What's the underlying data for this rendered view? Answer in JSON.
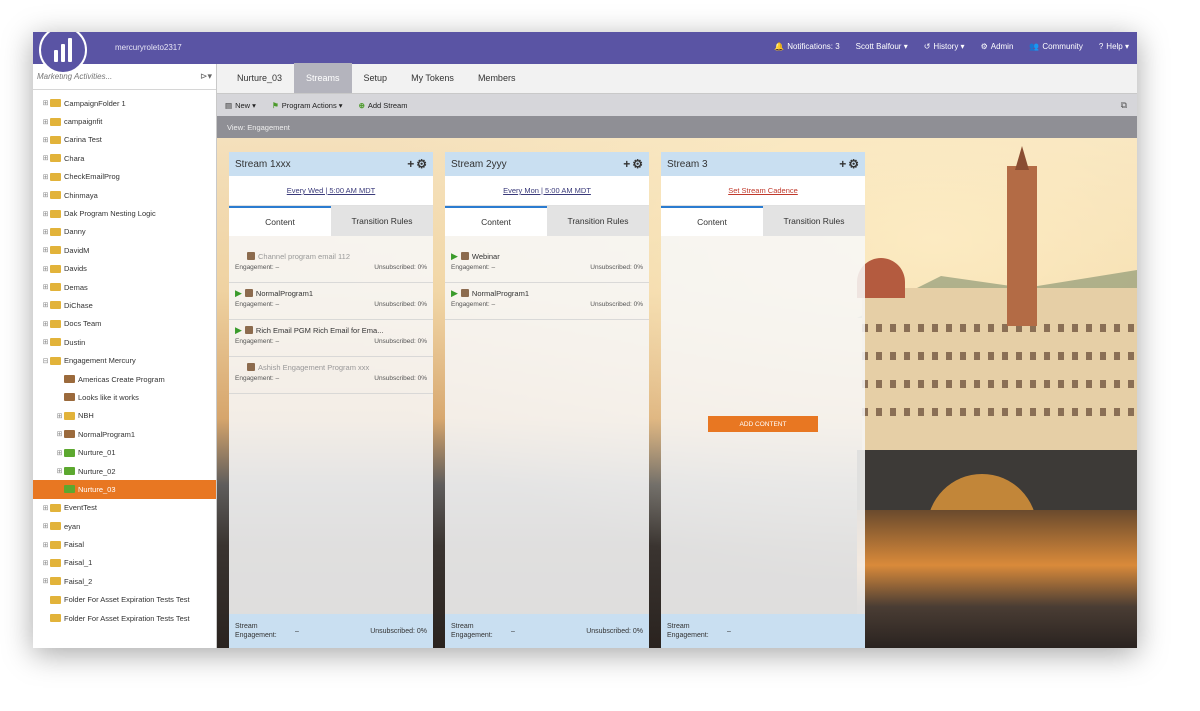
{
  "app": {
    "subscription": "mercuryroleto2317"
  },
  "topnav": [
    {
      "icon": "bell-icon",
      "glyph": "🔔",
      "label": "Notifications: 3"
    },
    {
      "icon": "user-icon",
      "glyph": "",
      "label": "Scott Balfour ▾"
    },
    {
      "icon": "history-icon",
      "glyph": "↺",
      "label": "History ▾"
    },
    {
      "icon": "admin-icon",
      "glyph": "⚙",
      "label": "Admin"
    },
    {
      "icon": "community-icon",
      "glyph": "👥",
      "label": "Community"
    },
    {
      "icon": "help-icon",
      "glyph": "?",
      "label": "Help ▾"
    }
  ],
  "sidebar": {
    "search_placeholder": "Marketing Activities...",
    "items": [
      {
        "label": "CampaignFolder 1",
        "type": "folder",
        "indent": 0,
        "exp": "⊞"
      },
      {
        "label": "campaignfit",
        "type": "folder",
        "indent": 0,
        "exp": "⊞"
      },
      {
        "label": "Carina Test",
        "type": "folder",
        "indent": 0,
        "exp": "⊞"
      },
      {
        "label": "Chara",
        "type": "folder",
        "indent": 0,
        "exp": "⊞"
      },
      {
        "label": "CheckEmailProg",
        "type": "folder",
        "indent": 0,
        "exp": "⊞"
      },
      {
        "label": "Chinmaya",
        "type": "folder",
        "indent": 0,
        "exp": "⊞"
      },
      {
        "label": "Dak Program Nesting Logic",
        "type": "folder",
        "indent": 0,
        "exp": "⊞"
      },
      {
        "label": "Danny",
        "type": "folder",
        "indent": 0,
        "exp": "⊞"
      },
      {
        "label": "DavidM",
        "type": "folder",
        "indent": 0,
        "exp": "⊞"
      },
      {
        "label": "Davids",
        "type": "folder",
        "indent": 0,
        "exp": "⊞"
      },
      {
        "label": "Demas",
        "type": "folder",
        "indent": 0,
        "exp": "⊞"
      },
      {
        "label": "DiChase",
        "type": "folder",
        "indent": 0,
        "exp": "⊞"
      },
      {
        "label": "Docs Team",
        "type": "folder",
        "indent": 0,
        "exp": "⊞"
      },
      {
        "label": "Dustin",
        "type": "folder",
        "indent": 0,
        "exp": "⊞"
      },
      {
        "label": "Engagement Mercury",
        "type": "folder",
        "indent": 0,
        "exp": "⊟"
      },
      {
        "label": "Americas Create Program",
        "type": "prog",
        "indent": 1,
        "exp": ""
      },
      {
        "label": "Looks like it works",
        "type": "prog",
        "indent": 1,
        "exp": ""
      },
      {
        "label": "NBH",
        "type": "folder",
        "indent": 1,
        "exp": "⊞"
      },
      {
        "label": "NormalProgram1",
        "type": "prog",
        "indent": 1,
        "exp": "⊞"
      },
      {
        "label": "Nurture_01",
        "type": "nurture",
        "indent": 1,
        "exp": "⊞"
      },
      {
        "label": "Nurture_02",
        "type": "nurture",
        "indent": 1,
        "exp": "⊞"
      },
      {
        "label": "Nurture_03",
        "type": "nurture",
        "indent": 1,
        "exp": "",
        "selected": true
      },
      {
        "label": "EventTest",
        "type": "folder",
        "indent": 0,
        "exp": "⊞"
      },
      {
        "label": "eyan",
        "type": "folder",
        "indent": 0,
        "exp": "⊞"
      },
      {
        "label": "Faisal",
        "type": "folder",
        "indent": 0,
        "exp": "⊞"
      },
      {
        "label": "Faisal_1",
        "type": "folder",
        "indent": 0,
        "exp": "⊞"
      },
      {
        "label": "Faisal_2",
        "type": "folder",
        "indent": 0,
        "exp": "⊞"
      },
      {
        "label": "Folder For Asset Expiration Tests Test",
        "type": "folder",
        "indent": 0,
        "exp": ""
      },
      {
        "label": "Folder For Asset Expiration Tests Test",
        "type": "folder",
        "indent": 0,
        "exp": ""
      }
    ]
  },
  "tabs": [
    "Nurture_03",
    "Streams",
    "Setup",
    "My Tokens",
    "Members"
  ],
  "active_tab": 1,
  "toolbar": {
    "new_label": "New ▾",
    "program_actions_label": "Program Actions ▾",
    "add_stream_label": "Add Stream"
  },
  "view_label": "View: Engagement",
  "streams": [
    {
      "title": "Stream 1xxx",
      "schedule": "Every Wed | 5:00 AM MDT",
      "schedule_warning": false,
      "tab_content": "Content",
      "tab_rules": "Transition Rules",
      "items": [
        {
          "name": "Channel program email 112",
          "active": false,
          "engagement": "Engagement: –",
          "unsub": "Unsubscribed: 0%"
        },
        {
          "name": "NormalProgram1",
          "active": true,
          "engagement": "Engagement: –",
          "unsub": "Unsubscribed: 0%"
        },
        {
          "name": "Rich Email PGM Rich Email for Ema...",
          "active": true,
          "engagement": "Engagement: –",
          "unsub": "Unsubscribed: 0%"
        },
        {
          "name": "Ashish Engagement Program xxx",
          "active": false,
          "engagement": "Engagement: –",
          "unsub": "Unsubscribed: 0%"
        }
      ],
      "footer_label": "Stream Engagement:",
      "footer_value": "–",
      "footer_unsub": "Unsubscribed: 0%"
    },
    {
      "title": "Stream 2yyy",
      "schedule": "Every Mon | 5:00 AM MDT",
      "schedule_warning": false,
      "tab_content": "Content",
      "tab_rules": "Transition Rules",
      "items": [
        {
          "name": "Webinar",
          "active": true,
          "engagement": "Engagement: –",
          "unsub": "Unsubscribed: 0%"
        },
        {
          "name": "NormalProgram1",
          "active": true,
          "engagement": "Engagement: –",
          "unsub": "Unsubscribed: 0%"
        }
      ],
      "footer_label": "Stream Engagement:",
      "footer_value": "–",
      "footer_unsub": "Unsubscribed: 0%"
    },
    {
      "title": "Stream 3",
      "schedule": "Set Stream Cadence",
      "schedule_warning": true,
      "tab_content": "Content",
      "tab_rules": "Transition Rules",
      "items": [],
      "add_content_label": "ADD CONTENT",
      "footer_label": "Stream Engagement:",
      "footer_value": "–",
      "footer_unsub": ""
    }
  ],
  "colors": {
    "brand": "#5a54a4",
    "selected": "#e87722",
    "stream_header": "#c9dff1"
  }
}
